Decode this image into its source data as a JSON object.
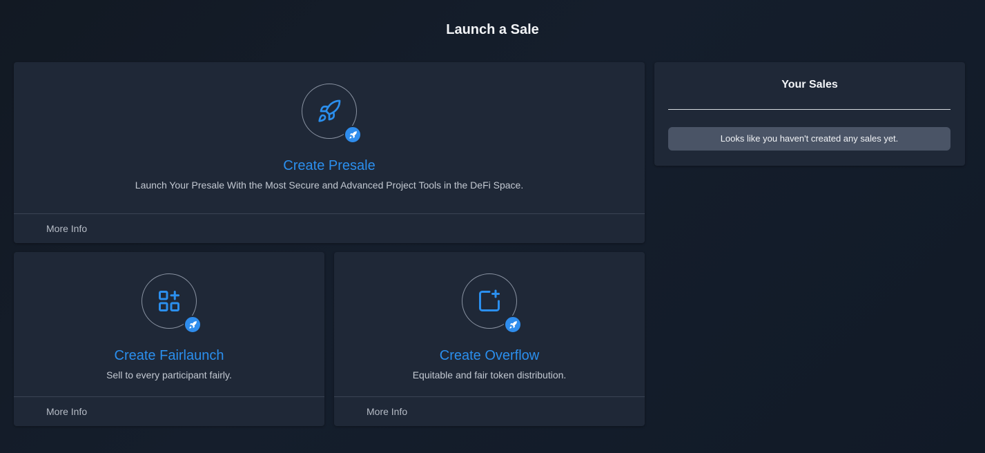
{
  "page": {
    "title": "Launch a Sale"
  },
  "colors": {
    "accent": "#2b8fee",
    "card_bg": "#1f2837",
    "badge": "#2f8ded"
  },
  "cards": [
    {
      "title": "Create Presale",
      "description": "Launch Your Presale With the Most Secure and Advanced Project Tools in the DeFi Space.",
      "more_info": "More Info",
      "icon": "rocket-icon"
    },
    {
      "title": "Create Fairlaunch",
      "description": "Sell to every participant fairly.",
      "more_info": "More Info",
      "icon": "grid-plus-icon"
    },
    {
      "title": "Create Overflow",
      "description": "Equitable and fair token distribution.",
      "more_info": "More Info",
      "icon": "square-plus-icon"
    }
  ],
  "sales": {
    "title": "Your Sales",
    "empty_message": "Looks like you haven't created any sales yet."
  }
}
